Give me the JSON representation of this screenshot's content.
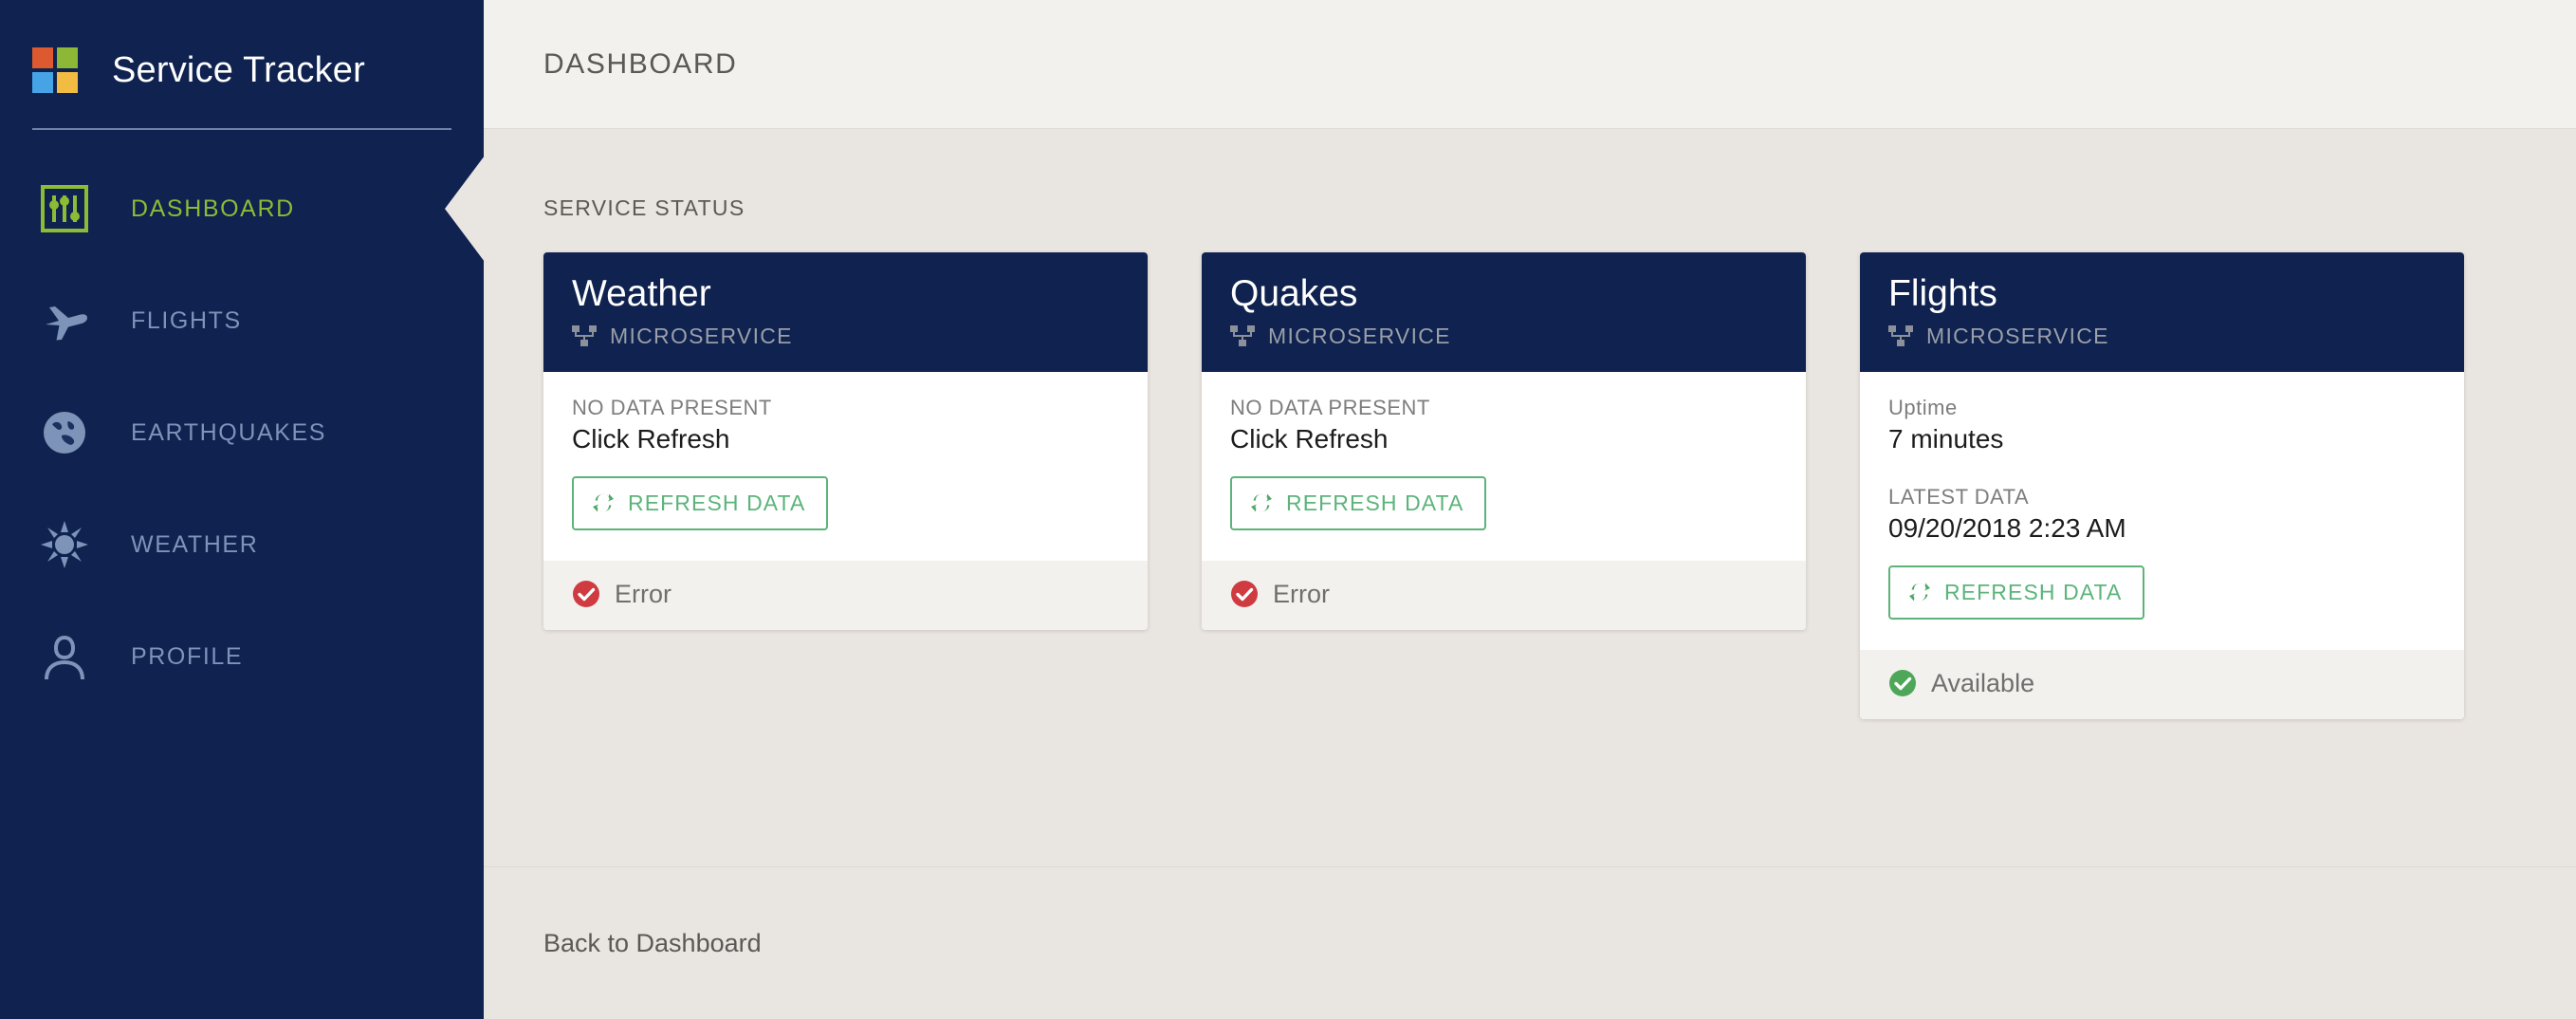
{
  "brand": {
    "title": "Service Tracker",
    "logo_colors": [
      "#dd5930",
      "#8cb737",
      "#45a3e6",
      "#f2bb42"
    ]
  },
  "sidebar": {
    "items": [
      {
        "label": "DASHBOARD",
        "icon": "sliders-icon",
        "active": true
      },
      {
        "label": "FLIGHTS",
        "icon": "airplane-icon",
        "active": false
      },
      {
        "label": "EARTHQUAKES",
        "icon": "globe-icon",
        "active": false
      },
      {
        "label": "WEATHER",
        "icon": "sun-icon",
        "active": false
      },
      {
        "label": "PROFILE",
        "icon": "person-icon",
        "active": false
      }
    ],
    "active_color": "#8cbb35",
    "inactive_color": "#7e93b8",
    "background": "#0f2250"
  },
  "header": {
    "title": "DASHBOARD"
  },
  "section": {
    "label": "SERVICE STATUS"
  },
  "cards": [
    {
      "title": "Weather",
      "subtitle": "MICROSERVICE",
      "subtitle_icon": "sitemap-icon",
      "fields": [
        {
          "label": "NO DATA PRESENT",
          "value": "Click Refresh"
        }
      ],
      "button": {
        "label": "REFRESH DATA",
        "icon": "refresh-icon"
      },
      "status": {
        "text": "Error",
        "icon": "check-circle-icon",
        "color": "#cf3b40"
      }
    },
    {
      "title": "Quakes",
      "subtitle": "MICROSERVICE",
      "subtitle_icon": "sitemap-icon",
      "fields": [
        {
          "label": "NO DATA PRESENT",
          "value": "Click Refresh"
        }
      ],
      "button": {
        "label": "REFRESH DATA",
        "icon": "refresh-icon"
      },
      "status": {
        "text": "Error",
        "icon": "check-circle-icon",
        "color": "#cf3b40"
      }
    },
    {
      "title": "Flights",
      "subtitle": "MICROSERVICE",
      "subtitle_icon": "sitemap-icon",
      "fields": [
        {
          "label": "Uptime",
          "value": "7 minutes"
        },
        {
          "label": "LATEST DATA",
          "value": "09/20/2018 2:23 AM"
        }
      ],
      "button": {
        "label": "REFRESH DATA",
        "icon": "refresh-icon"
      },
      "status": {
        "text": "Available",
        "icon": "check-circle-icon",
        "color": "#4ea758"
      }
    }
  ],
  "footer": {
    "link_label": "Back to Dashboard"
  },
  "theme": {
    "navy": "#0f2250",
    "body_bg": "#e9e5e1",
    "header_bg": "#f2f1ee",
    "green_accent": "#5cb47a",
    "error_red": "#cf3b40",
    "available_green": "#4ea758"
  }
}
